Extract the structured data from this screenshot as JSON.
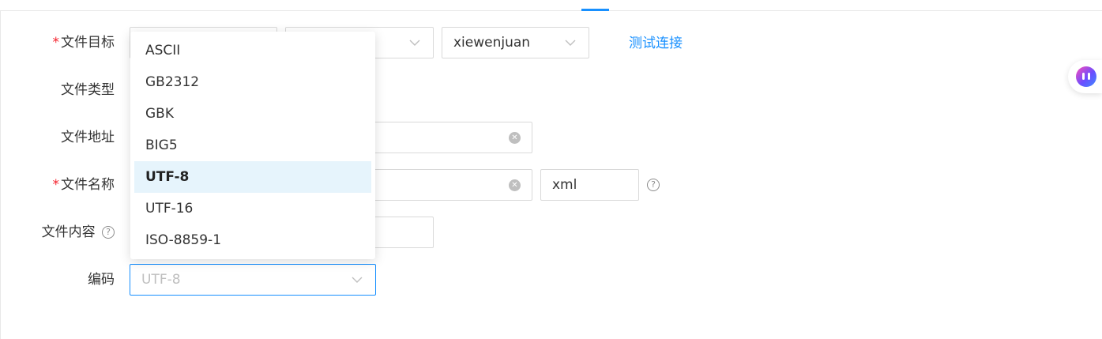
{
  "form": {
    "target": {
      "label": "文件目标",
      "required": "*",
      "select3_value": "xiewenjuan",
      "test_link": "测试连接"
    },
    "type": {
      "label": "文件类型"
    },
    "address": {
      "label": "文件地址"
    },
    "name": {
      "label": "文件名称",
      "required": "*",
      "ext_value": "xml"
    },
    "content": {
      "label": "文件内容"
    },
    "encoding": {
      "label": "编码",
      "value": "UTF-8"
    }
  },
  "dropdown": {
    "options": [
      "ASCII",
      "GB2312",
      "GBK",
      "BIG5",
      "UTF-8",
      "UTF-16",
      "ISO-8859-1"
    ],
    "active": "UTF-8"
  },
  "icons": {
    "clear": "clear-circle-icon",
    "chevron": "chevron-down-icon",
    "help": "question-circle-icon",
    "assistant": "ai-assistant-icon"
  },
  "colors": {
    "accent": "#1890ff",
    "required": "#f5222d",
    "active_option_bg": "#e6f4fc"
  }
}
